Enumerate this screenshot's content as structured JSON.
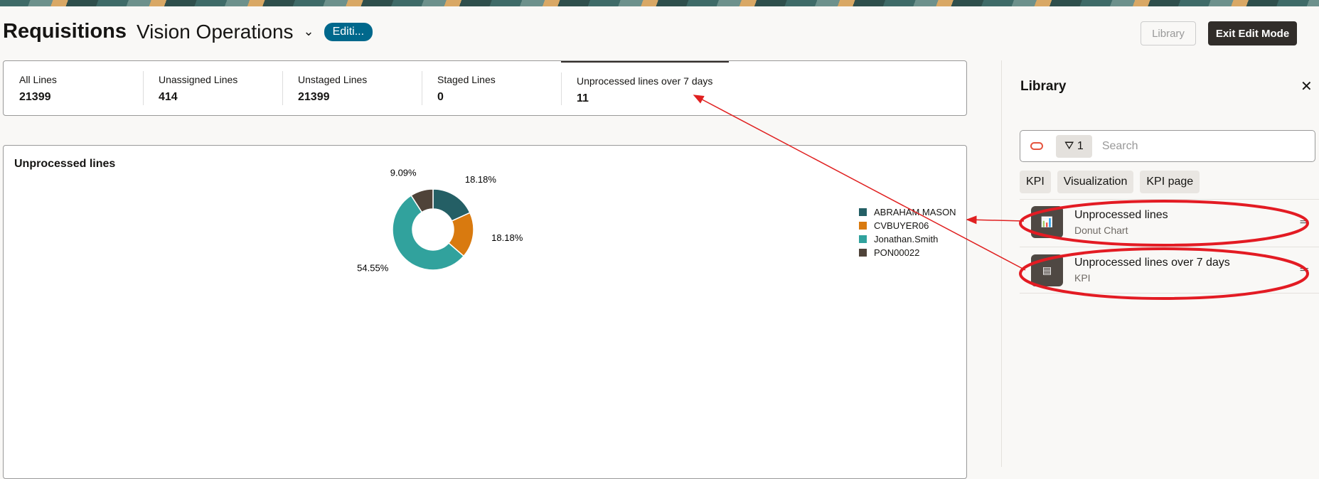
{
  "header": {
    "title": "Requisitions",
    "org": "Vision Operations",
    "badge": "Editi...",
    "library_button": "Library",
    "exit_button": "Exit Edit Mode"
  },
  "kpis": [
    {
      "label": "All Lines",
      "value": "21399"
    },
    {
      "label": "Unassigned Lines",
      "value": "414"
    },
    {
      "label": "Unstaged Lines",
      "value": "21399"
    },
    {
      "label": "Staged Lines",
      "value": "0"
    },
    {
      "label": "Unprocessed lines over 7 days",
      "value": "11"
    }
  ],
  "chart_data": {
    "type": "pie",
    "donut": true,
    "title": "Unprocessed lines",
    "categories": [
      "ABRAHAM.MASON",
      "CVBUYER06",
      "Jonathan.Smith",
      "PON00022"
    ],
    "values": [
      18.18,
      18.18,
      54.55,
      9.09
    ],
    "labels": [
      "18.18%",
      "18.18%",
      "54.55%",
      "9.09%"
    ],
    "colors": [
      "#245f65",
      "#d97a0f",
      "#31a29d",
      "#4f4339"
    ],
    "legend": "right"
  },
  "library": {
    "title": "Library",
    "filter_count": "1",
    "search_placeholder": "Search",
    "chips": [
      "KPI",
      "Visualization",
      "KPI page"
    ],
    "items": [
      {
        "title": "Unprocessed lines",
        "type": "Donut Chart"
      },
      {
        "title": "Unprocessed lines over 7 days",
        "type": "KPI"
      }
    ]
  }
}
